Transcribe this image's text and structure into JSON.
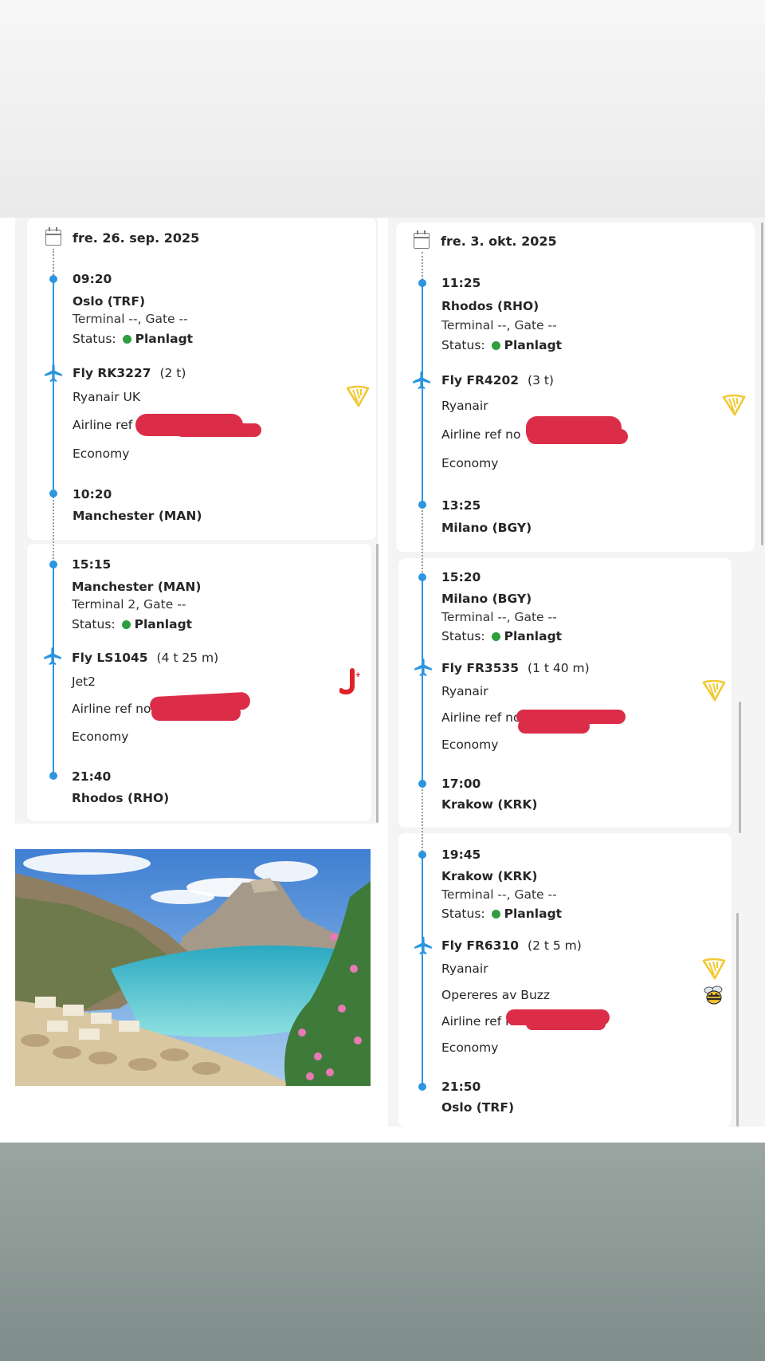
{
  "outbound": {
    "date": "fre. 26. sep. 2025",
    "legs": [
      {
        "dep_time": "09:20",
        "dep_airport": "Oslo (TRF)",
        "terminal": "Terminal --,  Gate --",
        "status_label": "Status:",
        "status_value": "Planlagt",
        "flight": "Fly RK3227",
        "duration": "(2 t)",
        "airline": "Ryanair UK",
        "ref_label": "Airline ref no",
        "cabin": "Economy",
        "arr_time": "10:20",
        "arr_airport": "Manchester (MAN)",
        "logo": "ryanair-harp-icon"
      },
      {
        "dep_time": "15:15",
        "dep_airport": "Manchester (MAN)",
        "terminal": "Terminal 2,  Gate --",
        "status_label": "Status:",
        "status_value": "Planlagt",
        "flight": "Fly LS1045",
        "duration": "(4 t 25 m)",
        "airline": "Jet2",
        "ref_label": "Airline ref no",
        "cabin": "Economy",
        "arr_time": "21:40",
        "arr_airport": "Rhodos (RHO)",
        "logo": "jet2-icon"
      }
    ]
  },
  "return": {
    "date": "fre. 3. okt. 2025",
    "legs": [
      {
        "dep_time": "11:25",
        "dep_airport": "Rhodos (RHO)",
        "terminal": "Terminal --,  Gate --",
        "status_label": "Status:",
        "status_value": "Planlagt",
        "flight": "Fly FR4202",
        "duration": "(3 t)",
        "airline": "Ryanair",
        "ref_label": "Airline ref no",
        "cabin": "Economy",
        "arr_time": "13:25",
        "arr_airport": "Milano (BGY)",
        "logo": "ryanair-harp-icon"
      },
      {
        "dep_time": "15:20",
        "dep_airport": "Milano (BGY)",
        "terminal": "Terminal --,  Gate --",
        "status_label": "Status:",
        "status_value": "Planlagt",
        "flight": "Fly FR3535",
        "duration": "(1 t 40 m)",
        "airline": "Ryanair",
        "ref_label": "Airline ref no",
        "cabin": "Economy",
        "arr_time": "17:00",
        "arr_airport": "Krakow (KRK)",
        "logo": "ryanair-harp-icon"
      },
      {
        "dep_time": "19:45",
        "dep_airport": "Krakow (KRK)",
        "terminal": "Terminal --,  Gate --",
        "status_label": "Status:",
        "status_value": "Planlagt",
        "flight": "Fly FR6310",
        "duration": "(2 t 5 m)",
        "airline": "Ryanair",
        "operated_by": "Opereres av Buzz",
        "ref_label": "Airline ref n",
        "cabin": "Economy",
        "arr_time": "21:50",
        "arr_airport": "Oslo (TRF)",
        "logo": "ryanair-harp-icon",
        "logo2": "buzz-bee-icon"
      }
    ]
  },
  "colors": {
    "accent": "#2b95e0",
    "status_green": "#2e9e3f",
    "redaction": "#dc2d48",
    "ryanair_gold": "#f1c933",
    "jet2_red": "#e2202a"
  },
  "photo": {
    "subject": "rhodes-bay-photo"
  }
}
